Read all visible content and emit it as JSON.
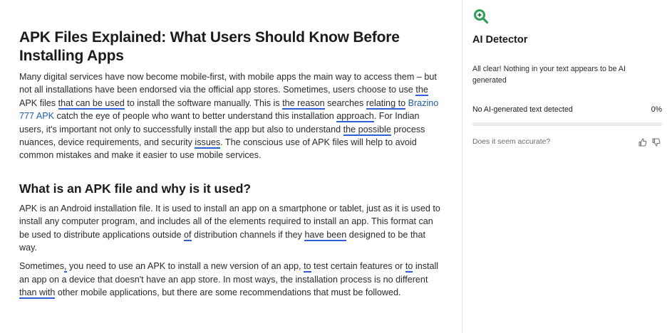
{
  "document": {
    "title": "APK Files Explained: What Users Should Know Before Installing Apps",
    "p1": {
      "t1": "Many digital services have now become mobile-first, with mobile apps the main way to access them – but not all installations have been endorsed via the official app stores. Sometimes, users choose to use ",
      "u1": "the",
      "t2": " APK files ",
      "u2": "that can be used",
      "t3": " to install the software manually. This is ",
      "u3": "the reason",
      "t4": " searches ",
      "u4": "relating to",
      "t5": " ",
      "link": "Brazino 777 APK",
      "t6": " catch the eye of people who want to better understand this installation ",
      "u5": "approach",
      "t7": ". For Indian users, it's important not only to successfully install the app but also to understand ",
      "u6": "the possible",
      "t8": " process nuances, device requirements, and security ",
      "u7": "issues",
      "t9": ". The conscious use of APK files will help to avoid common mistakes and make it easier to use mobile services."
    },
    "h2": "What is an APK file and why is it used?",
    "p2": {
      "t1": "APK is an Android installation file. It is used to install an app on a smartphone or tablet, just as it is used to install any computer program, and includes all of the elements required to install an app. This format can be used to distribute applications outside ",
      "u1": "of",
      "t2": " distribution channels if they ",
      "u2": "have been",
      "t3": " designed to be that way."
    },
    "p3": {
      "t1": "Sometimes",
      "u1": ",",
      "t2": " you need to use an APK to install a new version of an app, ",
      "u2": "to",
      "t3": " test certain features or ",
      "u3": "to",
      "t4": " install an app on a device that doesn't have an app store. In most ways, the installation process is no different ",
      "u4": "than with",
      "t5": " other mobile applications, but there are some recommendations that must be followed."
    }
  },
  "panel": {
    "logo_icon": "magnifier-sparkle-icon",
    "accent_color": "#2f9e5b",
    "title": "AI Detector",
    "message": "All clear! Nothing in your text appears to be AI generated",
    "result_label": "No AI-generated text detected",
    "result_value": "0%",
    "result_fraction": 0,
    "feedback_question": "Does it seem accurate?"
  }
}
